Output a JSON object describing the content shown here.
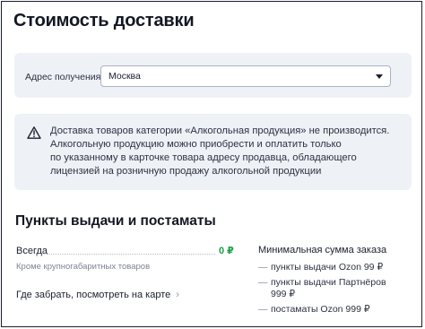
{
  "page": {
    "title": "Стоимость доставки"
  },
  "address": {
    "label": "Адрес получения",
    "value": "Москва"
  },
  "notice": {
    "icon": "warning-triangle-icon",
    "lines": [
      "Доставка товаров категории «Алкогольная продукция» не производится.",
      "Алкогольную продукцию можно приобрести и оплатить только",
      "по указанному в карточке товара адресу продавца, обладающего",
      "лицензией на розничную продажу алкогольной продукции"
    ]
  },
  "pickup": {
    "title": "Пункты выдачи и постаматы",
    "always_label": "Всегда",
    "always_price": "0 ₽",
    "exclusion": "Кроме крупногабаритных товаров",
    "map_link": "Где забрать, посмотреть на карте",
    "map_link_arrow": "›",
    "min_order": {
      "title": "Минимальная сумма заказа",
      "dash": "—",
      "items": [
        {
          "lines": [
            "пункты выдачи Ozon 99 ₽"
          ]
        },
        {
          "lines": [
            "пункты выдачи Партнёров",
            "999 ₽"
          ]
        },
        {
          "lines": [
            "постаматы Ozon 999 ₽"
          ]
        }
      ]
    }
  },
  "colors": {
    "free_price": "#1aa34a",
    "panel_bg": "#eef1f6",
    "muted_text": "#7c8494"
  }
}
